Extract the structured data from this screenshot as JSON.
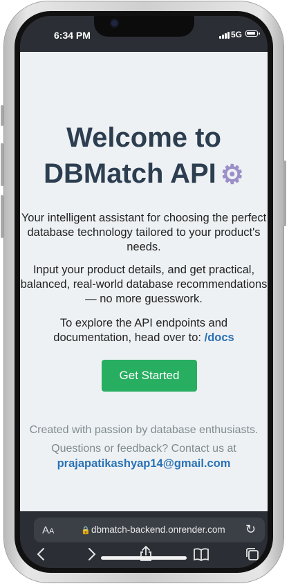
{
  "status_bar": {
    "time": "6:34 PM",
    "network": "5G"
  },
  "hero": {
    "title_line1": "Welcome to",
    "title_line2": "DBMatch API",
    "title_icon": "gear-icon"
  },
  "intro": {
    "paragraph1": "Your intelligent assistant for choosing the perfect database technology tailored to your product's needs.",
    "paragraph2": "Input your product details, and get practical, balanced, real-world database recommendations — no more guesswork.",
    "paragraph3_prefix": "To explore the API endpoints and documentation, head over to:",
    "docs_link": "/docs"
  },
  "cta": {
    "label": "Get Started",
    "color": "#27ae60"
  },
  "footer": {
    "credit": "Created with passion by database enthusiasts.",
    "contact_prefix": "Questions or feedback? Contact us at",
    "email": "prajapatikashyap14@gmail.com"
  },
  "browser": {
    "text_size_label_large": "A",
    "text_size_label_small": "A",
    "url": "dbmatch-backend.onrender.com",
    "icons": [
      "lock-icon",
      "reload-icon",
      "back-icon",
      "forward-icon",
      "share-icon",
      "bookmarks-icon",
      "tabs-icon"
    ]
  },
  "colors": {
    "title": "#2c3e50",
    "link": "#2a72b5",
    "muted": "#7f8c8d",
    "page_background": "#eef1f4",
    "chrome": "#2b2f35"
  }
}
